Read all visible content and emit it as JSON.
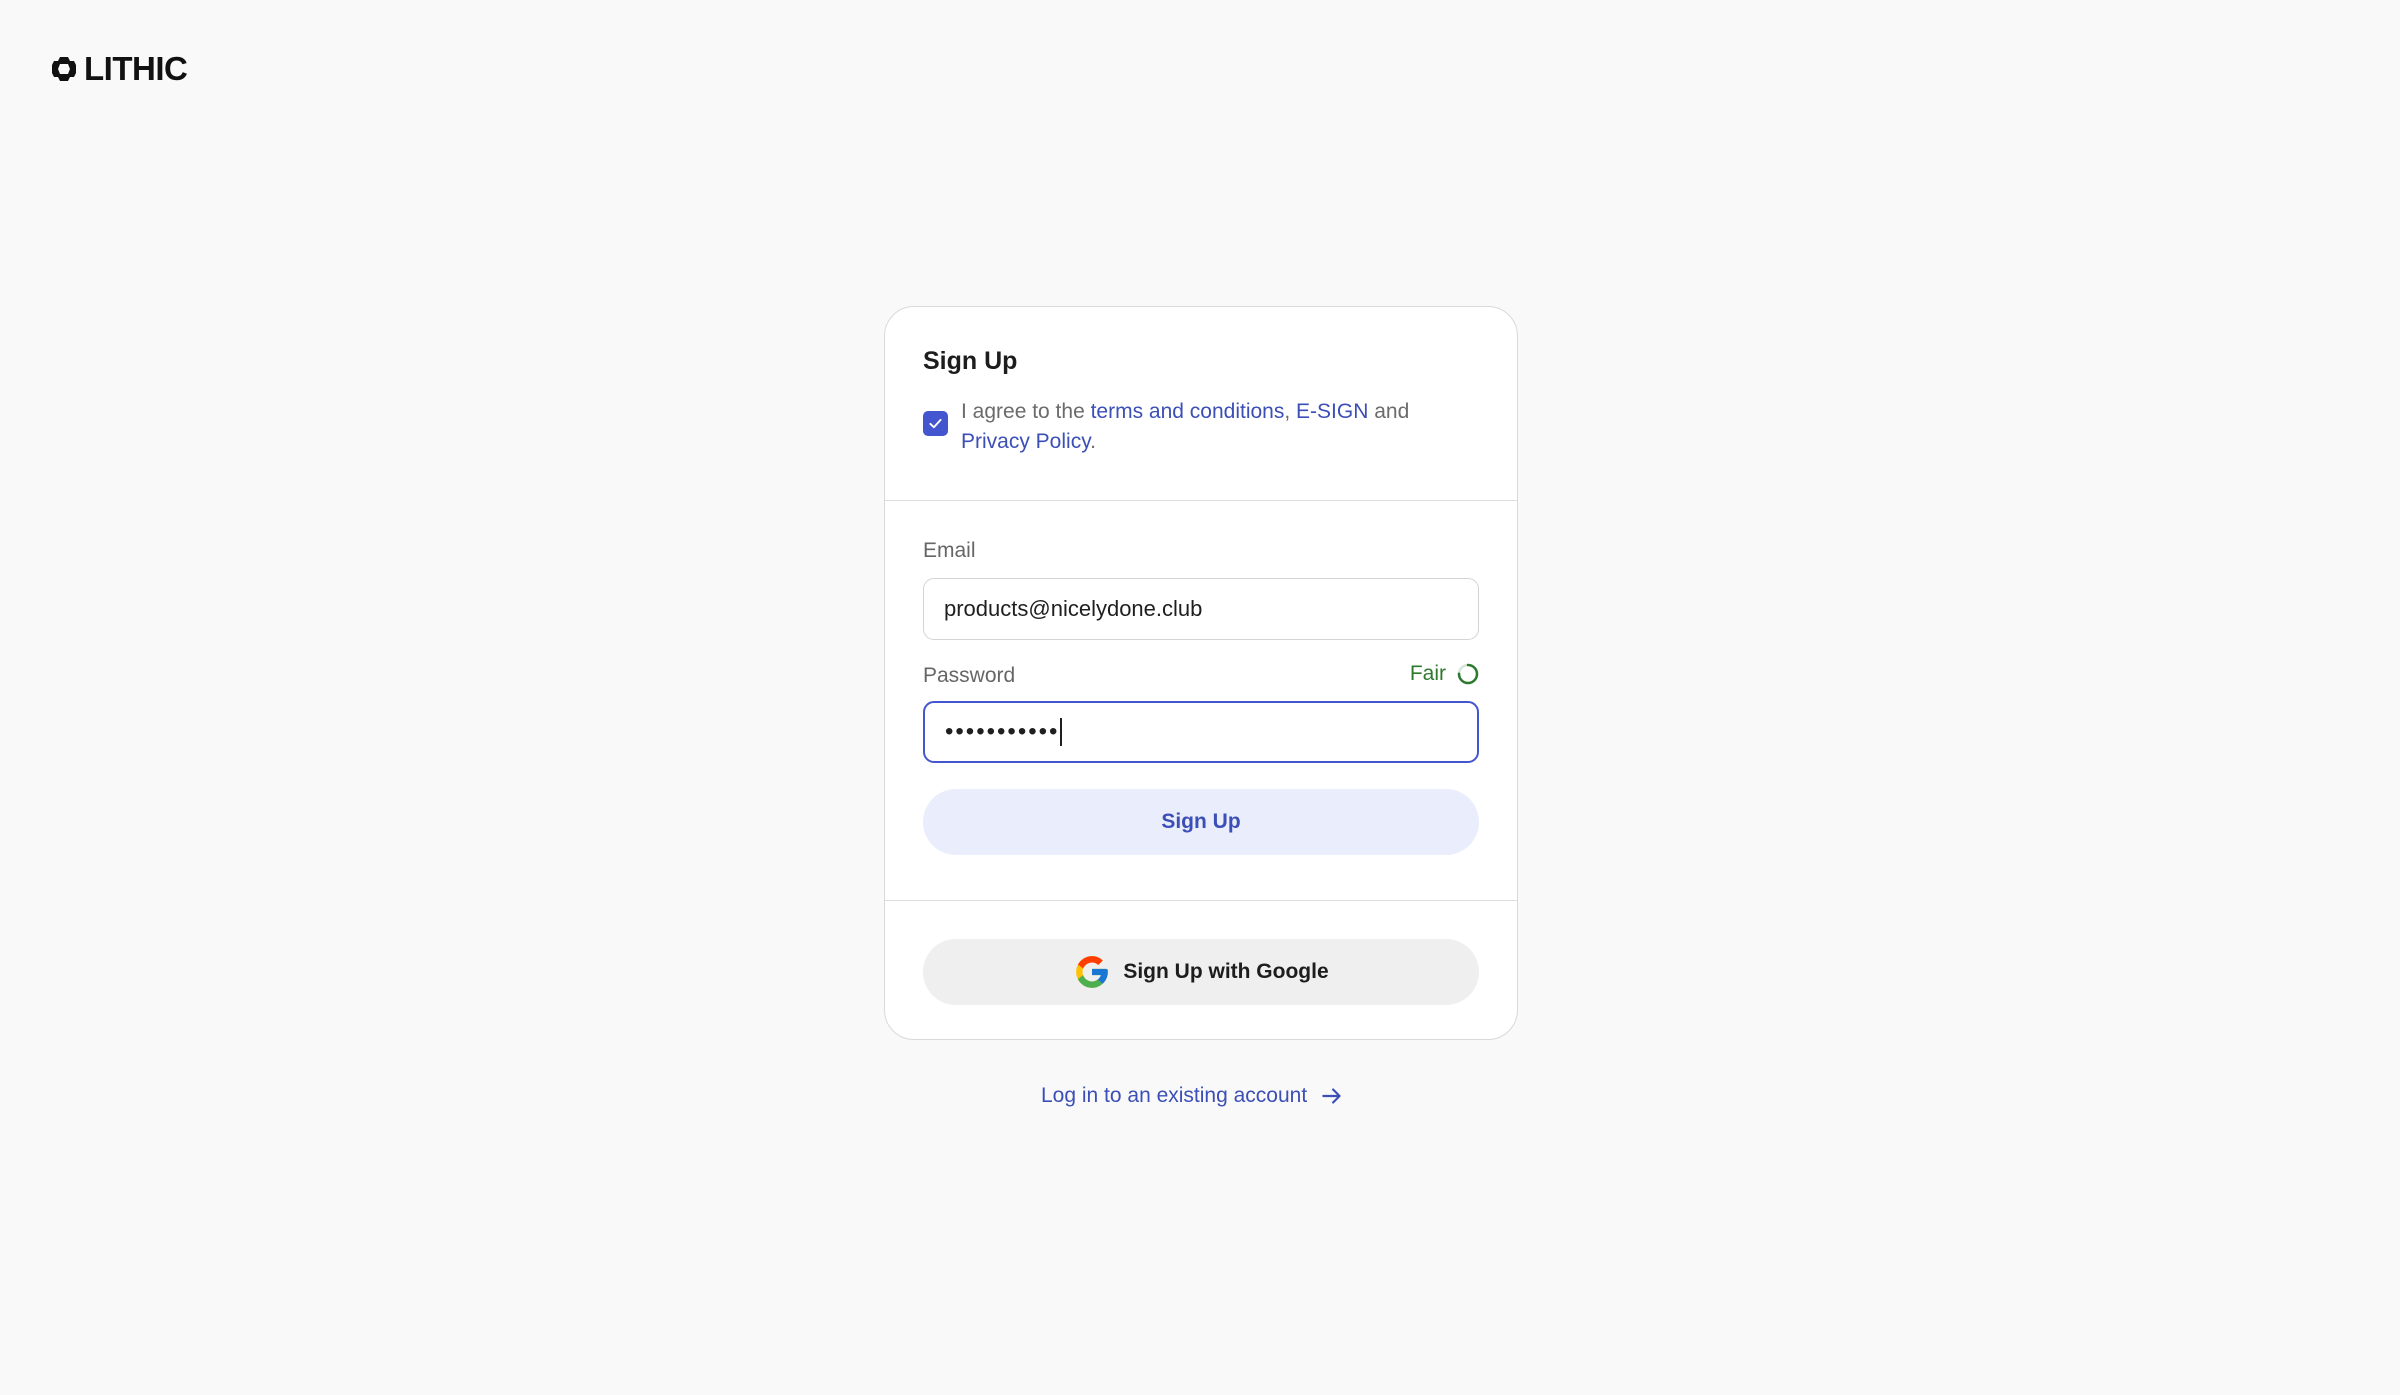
{
  "brand": {
    "name": "LITHIC",
    "icon": "lithic-logo-icon"
  },
  "signup_card": {
    "title": "Sign Up",
    "agreement": {
      "checked": true,
      "prefix": "I agree to the ",
      "terms_link": "terms and conditions",
      "sep1": ", ",
      "esign_link": "E-SIGN",
      "sep2": " and ",
      "privacy_link": "Privacy Policy",
      "suffix": "."
    },
    "email": {
      "label": "Email",
      "value": "products@nicelydone.club"
    },
    "password": {
      "label": "Password",
      "masked_value": "•••••••••••",
      "strength_label": "Fair",
      "strength_fraction": 0.75
    },
    "submit_label": "Sign Up",
    "google_label": "Sign Up with Google"
  },
  "login_link": {
    "label": "Log in to an existing account",
    "icon": "arrow-right-icon"
  },
  "colors": {
    "accent": "#4456cf",
    "link": "#3c4fb6",
    "strength_fair": "#2d7a2f",
    "primary_button_bg": "#eaedfb",
    "background": "#f9f9f9"
  }
}
